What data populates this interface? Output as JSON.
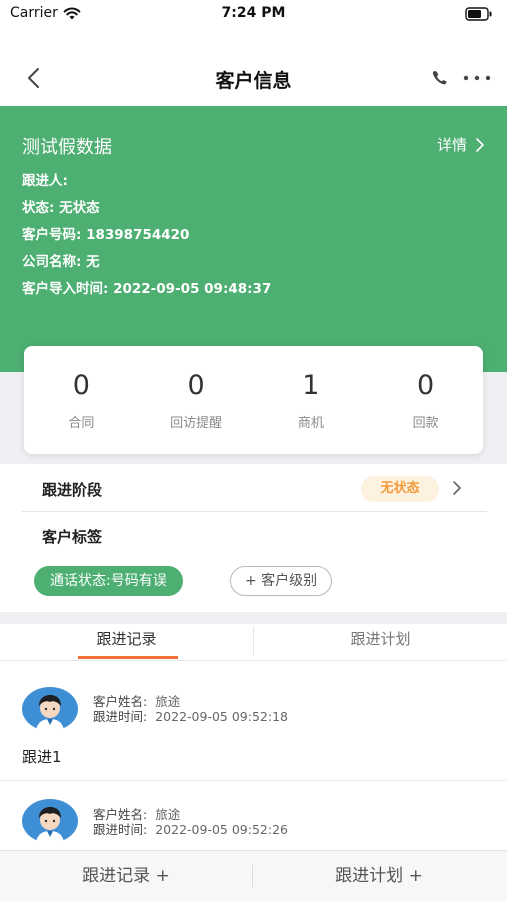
{
  "status_bar": {
    "carrier": "Carrier",
    "time": "7:24 PM"
  },
  "nav": {
    "title": "客户信息"
  },
  "customer": {
    "name": "测试假数据",
    "detail_link": "详情",
    "fields": [
      {
        "label": "跟进人:",
        "value": ""
      },
      {
        "label": "状态:",
        "value": "无状态"
      },
      {
        "label": "客户号码:",
        "value": "18398754420"
      },
      {
        "label": "公司名称:",
        "value": "无"
      },
      {
        "label": "客户导入时间:",
        "value": "2022-09-05 09:48:37"
      }
    ]
  },
  "stats": [
    {
      "value": "0",
      "label": "合同"
    },
    {
      "value": "0",
      "label": "回访提醒"
    },
    {
      "value": "1",
      "label": "商机"
    },
    {
      "value": "0",
      "label": "回款"
    }
  ],
  "stage": {
    "label": "跟进阶段",
    "badge": "无状态"
  },
  "tags": {
    "title": "客户标签",
    "active_tag": "通话状态:号码有误",
    "add_tag": "+ 客户级别"
  },
  "tabs": {
    "records": "跟进记录",
    "plans": "跟进计划"
  },
  "records": [
    {
      "name_label": "客户姓名:",
      "name": "旅途",
      "time_label": "跟进时间:",
      "time": "2022-09-05 09:52:18",
      "content": "跟进1"
    },
    {
      "name_label": "客户姓名:",
      "name": "旅途",
      "time_label": "跟进时间:",
      "time": "2022-09-05 09:52:26",
      "content": ""
    }
  ],
  "bottom_bar": {
    "add_record": "跟进记录 +",
    "add_plan": "跟进计划 +"
  },
  "colors": {
    "primary_green": "#4daf72",
    "accent_orange": "#f26f3a",
    "badge_orange": "#f29b3a",
    "badge_bg": "#fdf1df"
  }
}
